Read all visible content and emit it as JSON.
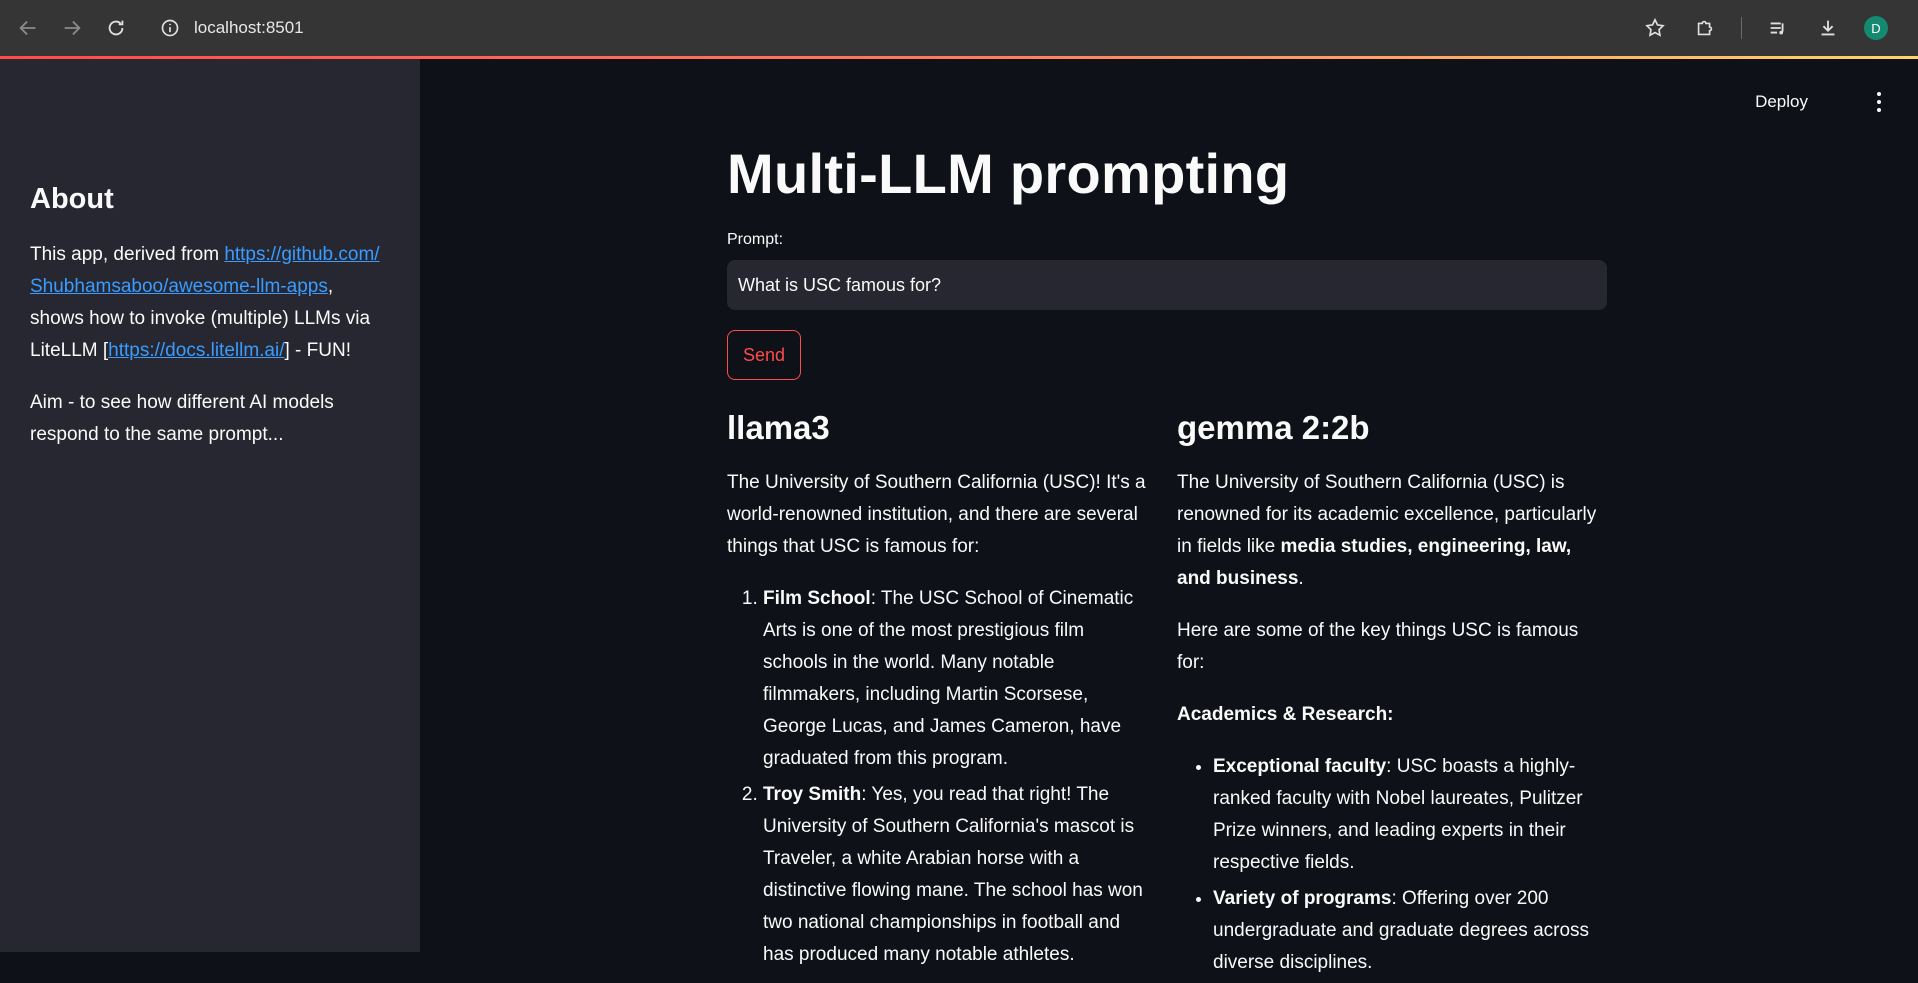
{
  "browser": {
    "url": "localhost:8501",
    "avatar_letter": "D",
    "colors": {
      "avatar": "#148a72"
    }
  },
  "sidebar": {
    "heading": "About",
    "p1_prefix": "This app, derived from ",
    "p1_link1": "https://github.com/Shubhamsaboo/awesome-llm-apps",
    "p1_mid": ", shows how to invoke (multiple) LLMs via LiteLLM [",
    "p1_link2": "https://docs.litellm.ai/",
    "p1_suffix": "] - FUN!",
    "p2": "Aim - to see how different AI models respond to the same prompt..."
  },
  "header": {
    "deploy_label": "Deploy"
  },
  "main": {
    "title": "Multi-LLM prompting",
    "prompt_label": "Prompt:",
    "prompt_value": "What is USC famous for?",
    "send_label": "Send",
    "accent_color": "#ff4b4b"
  },
  "columns": {
    "left": {
      "heading": "llama3",
      "intro": "The University of Southern California (USC)! It's a world-renowned institution, and there are several things that USC is famous for:",
      "items": [
        {
          "title": "Film School",
          "text": ": The USC School of Cinematic Arts is one of the most prestigious film schools in the world. Many notable filmmakers, including Martin Scorsese, George Lucas, and James Cameron, have graduated from this program."
        },
        {
          "title": "Troy Smith",
          "text": ": Yes, you read that right! The University of Southern California's mascot is Traveler, a white Arabian horse with a distinctive flowing mane. The school has won two national championships in football and has produced many notable athletes."
        }
      ]
    },
    "right": {
      "heading": "gemma 2:2b",
      "intro_prefix": "The University of Southern California (USC) is renowned for its academic excellence, particularly in fields like ",
      "intro_bold": "media studies, engineering, law, and business",
      "intro_suffix": ".",
      "p2": "Here are some of the key things USC is famous for:",
      "section": "Academics & Research:",
      "items": [
        {
          "title": "Exceptional faculty",
          "text": ": USC boasts a highly-ranked faculty with Nobel laureates, Pulitzer Prize winners, and leading experts in their respective fields."
        },
        {
          "title": "Variety of programs",
          "text": ": Offering over 200 undergraduate and graduate degrees across diverse disciplines."
        }
      ]
    }
  }
}
